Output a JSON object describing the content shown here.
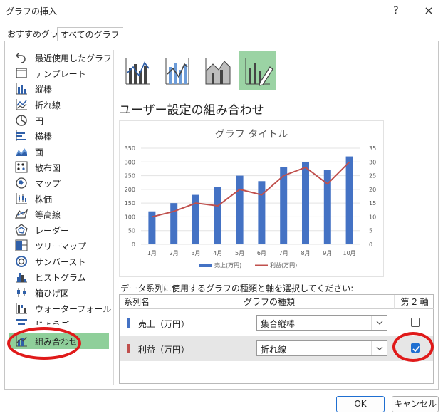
{
  "window": {
    "title": "グラフの挿入",
    "help": "?",
    "close": "×"
  },
  "tabs": [
    "おすすめグラフ",
    "すべてのグラフ"
  ],
  "sidebar": {
    "items": [
      {
        "label": "最近使用したグラフ",
        "icon": "recent-icon"
      },
      {
        "label": "テンプレート",
        "icon": "template-icon"
      },
      {
        "label": "縦棒",
        "icon": "column-chart-icon"
      },
      {
        "label": "折れ線",
        "icon": "line-chart-icon"
      },
      {
        "label": "円",
        "icon": "pie-chart-icon"
      },
      {
        "label": "横棒",
        "icon": "bar-chart-icon"
      },
      {
        "label": "面",
        "icon": "area-chart-icon"
      },
      {
        "label": "散布図",
        "icon": "scatter-chart-icon"
      },
      {
        "label": "マップ",
        "icon": "map-chart-icon"
      },
      {
        "label": "株価",
        "icon": "stock-chart-icon"
      },
      {
        "label": "等高線",
        "icon": "surface-chart-icon"
      },
      {
        "label": "レーダー",
        "icon": "radar-chart-icon"
      },
      {
        "label": "ツリーマップ",
        "icon": "treemap-chart-icon"
      },
      {
        "label": "サンバースト",
        "icon": "sunburst-chart-icon"
      },
      {
        "label": "ヒストグラム",
        "icon": "histogram-chart-icon"
      },
      {
        "label": "箱ひげ図",
        "icon": "boxwhisker-chart-icon"
      },
      {
        "label": "ウォーターフォール",
        "icon": "waterfall-chart-icon"
      },
      {
        "label": "じょうご",
        "icon": "funnel-chart-icon"
      },
      {
        "label": "組み合わせ",
        "icon": "combo-chart-icon"
      }
    ],
    "selected": "組み合わせ"
  },
  "main": {
    "section_title": "ユーザー設定の組み合わせ",
    "series_prompt": "データ系列に使用するグラフの種類と軸を選択してください:",
    "grid": {
      "headers": [
        "系列名",
        "グラフの種類",
        "第 2 軸"
      ],
      "rows": [
        {
          "name": "売上（万円）",
          "type": "集合縦棒",
          "secondary": false,
          "color": "#4472c4"
        },
        {
          "name": "利益（万円）",
          "type": "折れ線",
          "secondary": true,
          "color": "#c0504d"
        }
      ]
    }
  },
  "chart_data": {
    "type": "bar",
    "title": "グラフ タイトル",
    "categories": [
      "1月",
      "2月",
      "3月",
      "4月",
      "5月",
      "6月",
      "7月",
      "8月",
      "9月",
      "10月"
    ],
    "series": [
      {
        "name": "売上(万円)",
        "type": "bar",
        "axis": "primary",
        "color": "#4472c4",
        "values": [
          120,
          150,
          180,
          210,
          250,
          230,
          280,
          300,
          270,
          320
        ]
      },
      {
        "name": "利益(万円)",
        "type": "line",
        "axis": "secondary",
        "color": "#c0504d",
        "values": [
          10,
          12,
          15,
          14,
          20,
          18,
          25,
          28,
          22,
          30
        ]
      }
    ],
    "ylim": [
      0,
      350
    ],
    "y2lim": [
      0,
      35
    ],
    "yticks": [
      "0",
      "50",
      "100",
      "150",
      "200",
      "250",
      "300",
      "350"
    ],
    "y2ticks": [
      "0",
      "5",
      "10",
      "15",
      "20",
      "25",
      "30",
      "35"
    ],
    "legend": "bottom"
  },
  "buttons": {
    "ok": "OK",
    "cancel": "キャンセル"
  },
  "colors": {
    "selected_green": "#8fcf9a",
    "highlight_red": "#e01a1a",
    "accent_blue": "#1f6fd1"
  }
}
